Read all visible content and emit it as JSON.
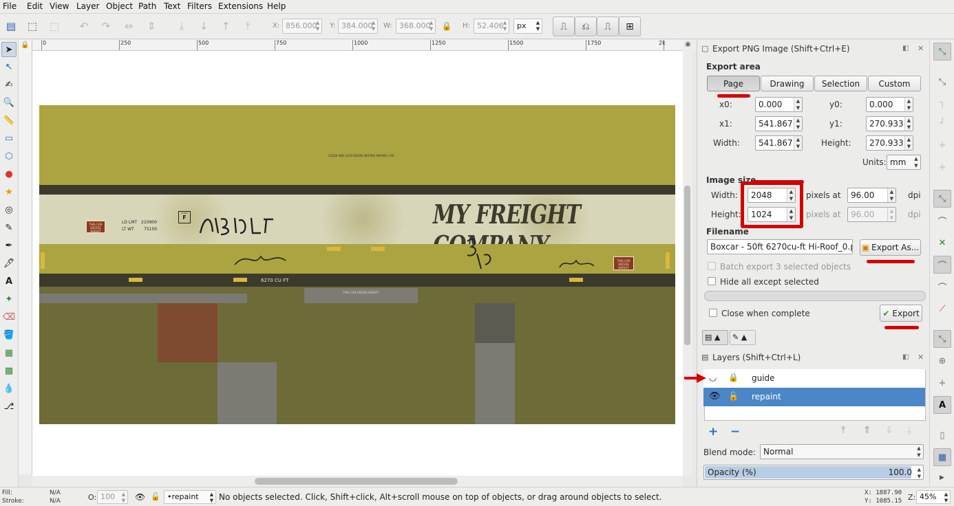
{
  "menu": [
    "File",
    "Edit",
    "View",
    "Layer",
    "Object",
    "Path",
    "Text",
    "Filters",
    "Extensions",
    "Help"
  ],
  "toolbar": {
    "x_label": "X:",
    "x_value": "856.000",
    "y_label": "Y:",
    "y_value": "384.000",
    "w_label": "W:",
    "w_value": "368.000",
    "h_label": "H:",
    "h_value": "52.406",
    "unit": "px"
  },
  "ruler": {
    "h_ticks": [
      "0",
      "250",
      "500",
      "750",
      "1000",
      "1250",
      "1500",
      "1750",
      "2k"
    ]
  },
  "artwork": {
    "company": "MY FREIGHT COMPANY",
    "small_top": "CLOSE AND LOCK DOORS BEFORE MOVING CAR",
    "ld_lmt": "LD LMT",
    "ld_lmt_val": "210900",
    "lt_wt": "LT WT",
    "lt_wt_val": "75100",
    "plate": "PLATE",
    "plate_letter": "F",
    "badge_left": "THIS CAR EXCESS HEIGHT",
    "badge_right": "THIS CAR EXCESS HEIGHT",
    "capacity": "6270 CU FT",
    "excess": "THIS CAR EXCESS HEIGHT",
    "colors": {
      "olive": "#aba441",
      "dark_band": "#3b3a2b",
      "light_band": "#d8d6b9",
      "lower": "#6d6b38",
      "rust": "#8a3a1e"
    }
  },
  "export_dialog": {
    "title": "Export PNG Image (Shift+Ctrl+E)",
    "area_heading": "Export area",
    "area_buttons": [
      "Page",
      "Drawing",
      "Selection",
      "Custom"
    ],
    "x0_label": "x0:",
    "x0": "0.000",
    "y0_label": "y0:",
    "y0": "0.000",
    "x1_label": "x1:",
    "x1": "541.867",
    "y1_label": "y1:",
    "y1": "270.933",
    "width_label": "Width:",
    "width": "541.867",
    "height_label": "Height:",
    "height": "270.933",
    "units_label": "Units:",
    "units": "mm",
    "image_size_heading": "Image size",
    "img_width_label": "Width:",
    "img_width": "2048",
    "img_height_label": "Height:",
    "img_height": "1024",
    "pixels_at": "pixels at",
    "dpi_x": "96.00",
    "dpi_y": "96.00",
    "dpi": "dpi",
    "filename_heading": "Filename",
    "filename": "Boxcar - 50ft 6270cu-ft Hi-Roof_0.png",
    "export_as_button": "Export As...",
    "batch_label": "Batch export 3 selected objects",
    "hide_label": "Hide all except selected",
    "close_label": "Close when complete",
    "export_button": "Export"
  },
  "layers_dialog": {
    "title": "Layers (Shift+Ctrl+L)",
    "layers": [
      {
        "name": "guide",
        "selected": false
      },
      {
        "name": "repaint",
        "selected": true
      }
    ],
    "blend_label": "Blend mode:",
    "blend_value": "Normal",
    "opacity_label": "Opacity (%)",
    "opacity_value": "100.0",
    "opacity_fraction": 1.0
  },
  "status": {
    "fill_label": "Fill:",
    "fill_value": "N/A",
    "stroke_label": "Stroke:",
    "stroke_value": "N/A",
    "o_label": "O:",
    "o_value": "100",
    "layer": "•repaint",
    "message": "No objects selected. Click, Shift+click, Alt+scroll mouse on top of objects, or drag around objects to select.",
    "x_coord": "X: 1887.90",
    "y_coord": "Y: 1085.15",
    "zoom_label": "Z:",
    "zoom": "45%"
  }
}
